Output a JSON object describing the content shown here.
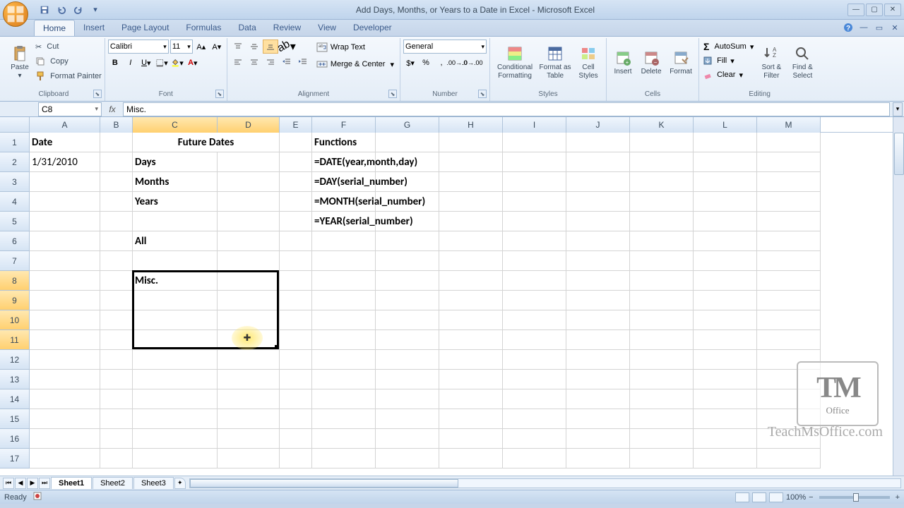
{
  "title": "Add Days, Months, or Years to a Date in Excel - Microsoft Excel",
  "tabs": {
    "home": "Home",
    "insert": "Insert",
    "layout": "Page Layout",
    "formulas": "Formulas",
    "data": "Data",
    "review": "Review",
    "view": "View",
    "developer": "Developer"
  },
  "clipboard": {
    "paste": "Paste",
    "cut": "Cut",
    "copy": "Copy",
    "painter": "Format Painter",
    "group": "Clipboard"
  },
  "font": {
    "name": "Calibri",
    "size": "11",
    "group": "Font"
  },
  "alignment": {
    "wrap": "Wrap Text",
    "merge": "Merge & Center",
    "group": "Alignment"
  },
  "number": {
    "format": "General",
    "group": "Number"
  },
  "styles": {
    "cond": "Conditional Formatting",
    "table": "Format as Table",
    "cell": "Cell Styles",
    "group": "Styles"
  },
  "cellsg": {
    "insert": "Insert",
    "delete": "Delete",
    "format": "Format",
    "group": "Cells"
  },
  "editing": {
    "sum": "AutoSum",
    "fill": "Fill",
    "clear": "Clear",
    "sort": "Sort & Filter",
    "find": "Find & Select",
    "group": "Editing"
  },
  "namebox": "C8",
  "formula": "Misc.",
  "cols": [
    "A",
    "B",
    "C",
    "D",
    "E",
    "F",
    "G",
    "H",
    "I",
    "J",
    "K",
    "L",
    "M"
  ],
  "colwidths": {
    "A": 100,
    "B": 46,
    "C": 120,
    "D": 88,
    "E": 46,
    "F": 90,
    "G": 90,
    "H": 90,
    "I": 90,
    "J": 90,
    "K": 90,
    "L": 90,
    "M": 90
  },
  "selected_cols": [
    "C",
    "D"
  ],
  "selected_rows": [
    8,
    9,
    10,
    11
  ],
  "selection": {
    "top_row": 8,
    "left_col": "C",
    "bottom_row": 11,
    "right_col": "D",
    "active": "C8"
  },
  "cells": {
    "A1": {
      "v": "Date",
      "bold": true
    },
    "A2": {
      "v": "1/31/2010"
    },
    "C1": {
      "v": "Future Dates",
      "bold": true,
      "merge": "D1",
      "center": true
    },
    "C2": {
      "v": "Days",
      "bold": true
    },
    "C3": {
      "v": "Months",
      "bold": true
    },
    "C4": {
      "v": "Years",
      "bold": true
    },
    "C6": {
      "v": "All",
      "bold": true
    },
    "C8": {
      "v": "Misc.",
      "bold": true
    },
    "F1": {
      "v": "Functions",
      "bold": true
    },
    "F2": {
      "v": "=DATE(year,month,day)",
      "bold": true
    },
    "F3": {
      "v": "=DAY(serial_number)",
      "bold": true
    },
    "F4": {
      "v": "=MONTH(serial_number)",
      "bold": true
    },
    "F5": {
      "v": "=YEAR(serial_number)",
      "bold": true
    }
  },
  "sheets": {
    "s1": "Sheet1",
    "s2": "Sheet2",
    "s3": "Sheet3"
  },
  "status": "Ready",
  "zoom": "100%",
  "watermark": {
    "logo": "TM",
    "sub": "Office",
    "text": "TeachMsOffice.com"
  }
}
